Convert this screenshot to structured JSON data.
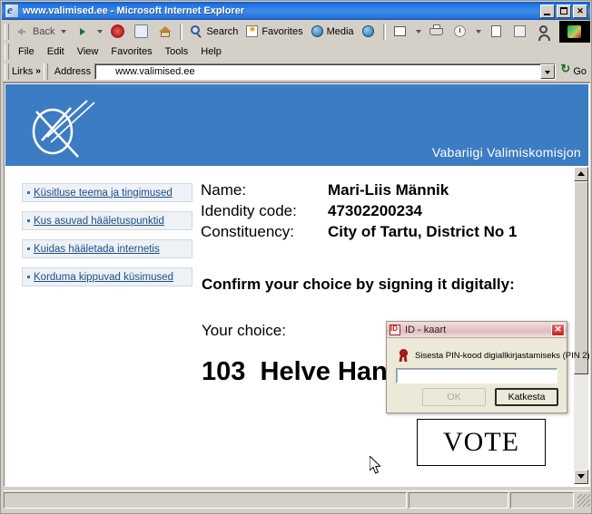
{
  "window": {
    "title": "www.valimised.ee - Microsoft Internet Explorer",
    "icon": "ie-page-icon",
    "minimize": "_",
    "maximize": "□",
    "close": "×"
  },
  "toolbar": {
    "back": "Back",
    "forward": "",
    "stop": "",
    "refresh": "",
    "home": "",
    "search": "Search",
    "favorites": "Favorites",
    "media": "Media",
    "history": "",
    "mail": "",
    "print": "",
    "discuss": "",
    "edit": "",
    "messenger": "",
    "research": ""
  },
  "menubar": {
    "items": [
      {
        "label": "File"
      },
      {
        "label": "Edit"
      },
      {
        "label": "View"
      },
      {
        "label": "Favorites"
      },
      {
        "label": "Tools"
      },
      {
        "label": "Help"
      }
    ]
  },
  "addressbar": {
    "links_label": "Lirks",
    "links_chevron": "»",
    "address_label": "Address",
    "url": "www.valimised.ee",
    "go_label": "Go"
  },
  "page": {
    "banner": {
      "organisation": "Vabariigi Valimiskomisjon",
      "logo": "crossed-ballot-logo"
    },
    "sidebar": {
      "items": [
        {
          "label": "Küsitluse teema ja tingimused"
        },
        {
          "label": "Kus asuvad hääletuspunktid"
        },
        {
          "label": "Kuidas hääletada internetis"
        },
        {
          "label": "Korduma kippuvad küsimused"
        }
      ]
    },
    "voter": {
      "name_label": "Name:",
      "name_value": "Mari-Liis Männik",
      "id_label": "Idendity code:",
      "id_value": "47302200234",
      "constituency_label": "Constituency:",
      "constituency_value": "City of Tartu, District No 1"
    },
    "confirm_heading": "Confirm your choice by signing it digitally:",
    "choice_label": "Your choice:",
    "choice_number": "103",
    "choice_name": "Helve Hani",
    "vote_button": "VOTE"
  },
  "scrollbar": {
    "up_arrow": "▲",
    "down_arrow": "▼"
  },
  "dialog": {
    "title": "ID - kaart",
    "icon": "id-card-icon",
    "close": "×",
    "prompt": "Sisesta PIN-kood digiallkirjastamiseks (PIN 2)",
    "prompt_icon": "digital-seal-icon",
    "pin_value": "",
    "ok_label": "OK",
    "cancel_label": "Katkesta"
  },
  "statusbar": {
    "message": "",
    "zone": "",
    "progress": ""
  },
  "colors": {
    "titlebar_blue": "#3d8ae8",
    "banner_blue": "#3c7cc2",
    "link_blue": "#1a4f8a",
    "dialog_red": "#c01818",
    "chrome_grey": "#d4d0c8"
  }
}
